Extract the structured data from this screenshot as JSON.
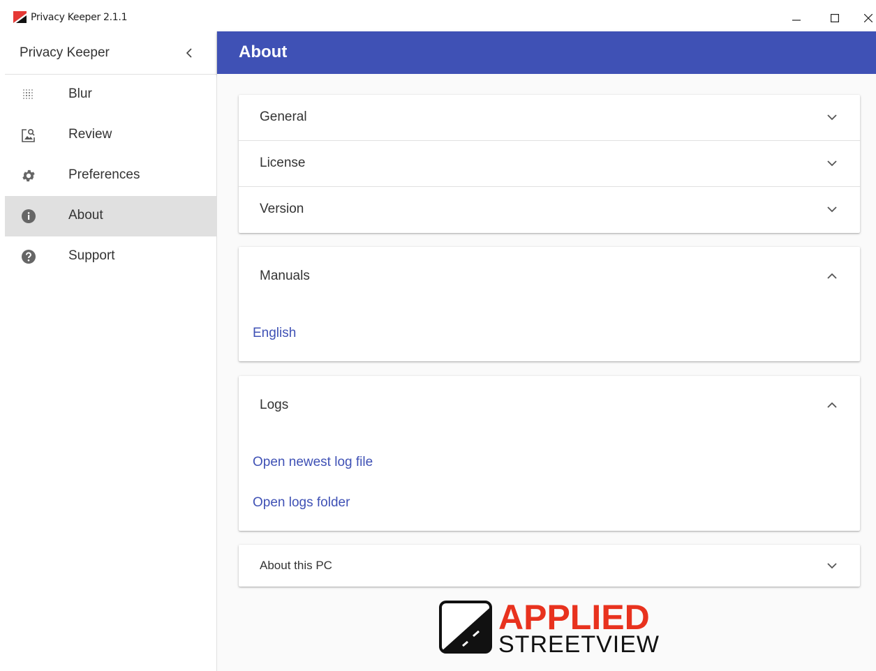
{
  "window": {
    "title": "Privacy Keeper 2.1.1",
    "buttons": [
      "minimize-icon",
      "maximize-icon",
      "close-icon"
    ]
  },
  "sidebar": {
    "app_name": "Privacy Keeper",
    "items": [
      {
        "label": "Blur",
        "icon": "blur-icon"
      },
      {
        "label": "Review",
        "icon": "review-icon"
      },
      {
        "label": "Preferences",
        "icon": "gear-icon"
      },
      {
        "label": "About",
        "icon": "info-icon",
        "active": true
      },
      {
        "label": "Support",
        "icon": "help-icon"
      }
    ]
  },
  "header": {
    "title": "About"
  },
  "panels": {
    "general": {
      "label": "General",
      "expanded": false
    },
    "license": {
      "label": "License",
      "expanded": false
    },
    "version": {
      "label": "Version",
      "expanded": false
    },
    "manuals": {
      "label": "Manuals",
      "expanded": true,
      "links": [
        "English"
      ]
    },
    "logs": {
      "label": "Logs",
      "expanded": true,
      "links": [
        "Open newest log file",
        "Open logs folder"
      ]
    },
    "about_pc": {
      "label": "About this PC",
      "expanded": false
    }
  },
  "logo": {
    "line1": "APPLIED",
    "line2": "STREETVIEW",
    "accent": "#e8321e"
  },
  "colors": {
    "primary": "#3f51b5",
    "active_nav": "#e0e0e0"
  }
}
